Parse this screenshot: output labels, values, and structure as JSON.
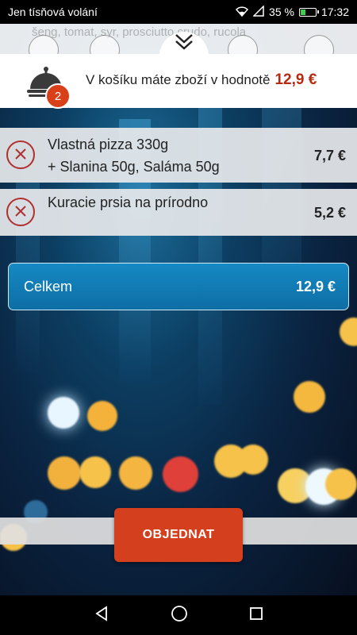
{
  "status_bar": {
    "carrier": "Jen tísňová volání",
    "battery_percent": "35 %",
    "battery_level": 0.35,
    "time": "17:32"
  },
  "category_strip": {
    "description": "šeng, tomat, syr, prosciutto crudo, rucola"
  },
  "cart_header": {
    "item_count": "2",
    "message": "V košíku máte zboží v hodnotě",
    "amount": "12,9 €"
  },
  "items": [
    {
      "line1": "Vlastná pizza 330g",
      "line2": "+ Slanina 50g, Saláma 50g",
      "price": "7,7 €"
    },
    {
      "line1": "Kuracie prsia na prírodno",
      "price": "5,2 €"
    }
  ],
  "total": {
    "label": "Celkem",
    "value": "12,9 €"
  },
  "order_button": {
    "label": "OBJEDNAT"
  },
  "colors": {
    "accent_red": "#d4401e",
    "total_blue": "#1689c4",
    "amount_red": "#b72a12"
  },
  "icons": [
    "wifi-icon",
    "signal-icon",
    "battery-icon",
    "chevron-double-down-icon",
    "cloche-icon",
    "remove-icon",
    "nav-back-icon",
    "nav-home-icon",
    "nav-recents-icon"
  ]
}
